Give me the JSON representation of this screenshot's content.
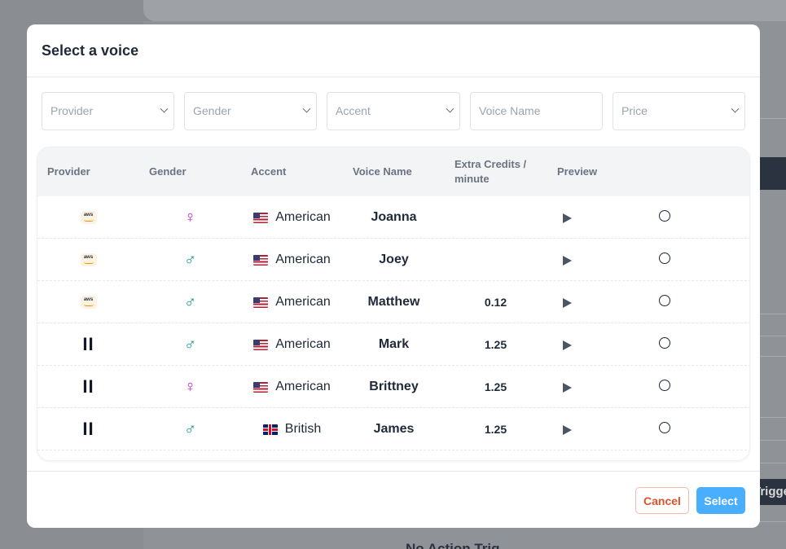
{
  "background": {
    "trigger_text": "Trigge",
    "bottom_text": "No Action Trig"
  },
  "modal": {
    "title": "Select a voice",
    "filters": {
      "provider": "Provider",
      "gender": "Gender",
      "accent": "Accent",
      "voice_name": "Voice Name",
      "price": "Price"
    },
    "columns": {
      "provider": "Provider",
      "gender": "Gender",
      "accent": "Accent",
      "voice_name": "Voice Name",
      "extra_credits": "Extra Credits / minute",
      "preview": "Preview"
    },
    "rows": [
      {
        "provider_icon": "aws-icon",
        "provider_text": "aws",
        "gender": "female",
        "gender_glyph": "♀",
        "flag": "us-flag-icon",
        "accent": "American",
        "voice": "Joanna",
        "credits": ""
      },
      {
        "provider_icon": "aws-icon",
        "provider_text": "aws",
        "gender": "male",
        "gender_glyph": "♂",
        "flag": "us-flag-icon",
        "accent": "American",
        "voice": "Joey",
        "credits": ""
      },
      {
        "provider_icon": "aws-icon",
        "provider_text": "aws",
        "gender": "male",
        "gender_glyph": "♂",
        "flag": "us-flag-icon",
        "accent": "American",
        "voice": "Matthew",
        "credits": "0.12"
      },
      {
        "provider_icon": "elevenlabs-icon",
        "provider_text": "II",
        "gender": "male",
        "gender_glyph": "♂",
        "flag": "us-flag-icon",
        "accent": "American",
        "voice": "Mark",
        "credits": "1.25"
      },
      {
        "provider_icon": "elevenlabs-icon",
        "provider_text": "II",
        "gender": "female",
        "gender_glyph": "♀",
        "flag": "us-flag-icon",
        "accent": "American",
        "voice": "Brittney",
        "credits": "1.25"
      },
      {
        "provider_icon": "elevenlabs-icon",
        "provider_text": "II",
        "gender": "male",
        "gender_glyph": "♂",
        "flag": "gb-flag-icon",
        "accent": "British",
        "voice": "James",
        "credits": "1.25"
      }
    ],
    "footer": {
      "cancel_label": "Cancel",
      "select_label": "Select"
    }
  },
  "colors": {
    "female": "#c026d3",
    "male": "#0d9488",
    "primary": "#4aaefe",
    "cancel": "#e0522b"
  }
}
